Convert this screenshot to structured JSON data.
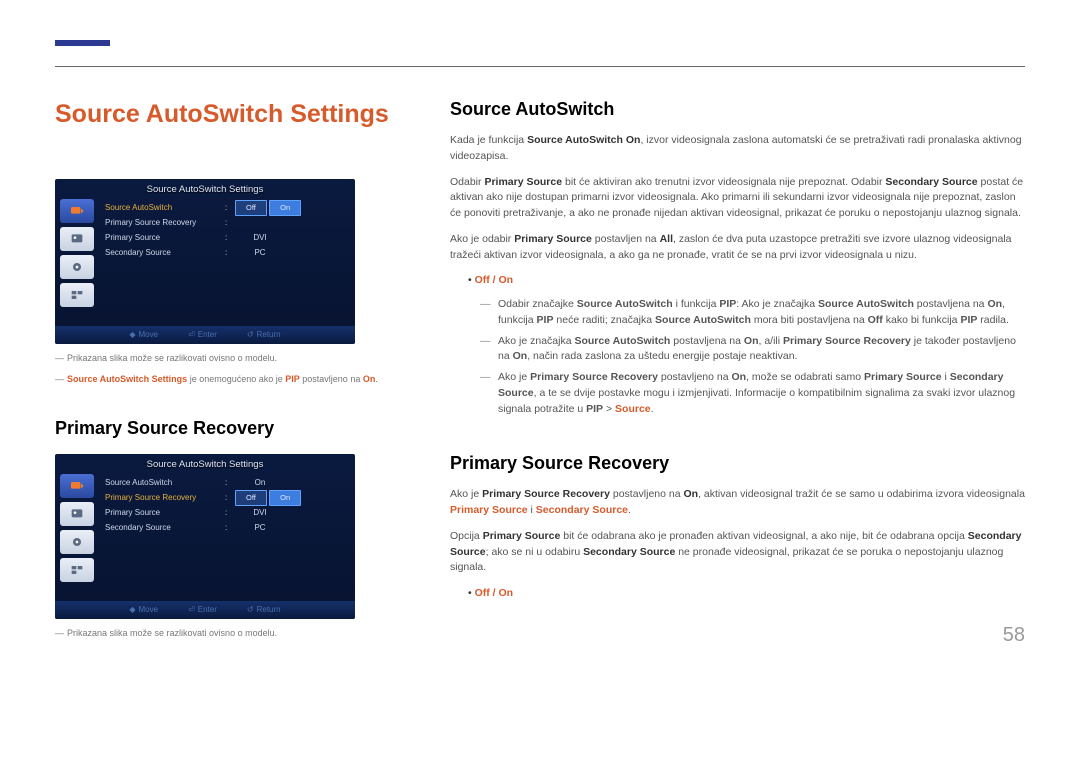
{
  "page_number": "58",
  "main_title": "Source AutoSwitch Settings",
  "left": {
    "osd1": {
      "title": "Source AutoSwitch Settings",
      "rows": [
        {
          "label": "Source AutoSwitch",
          "highlight": true,
          "pills": [
            "Off",
            "On"
          ],
          "active_pill": 1
        },
        {
          "label": "Primary Source Recovery",
          "value": ""
        },
        {
          "label": "Primary Source",
          "value": "DVI"
        },
        {
          "label": "Secondary Source",
          "value": "PC"
        }
      ],
      "footer": {
        "move": "Move",
        "enter": "Enter",
        "return": "Return"
      }
    },
    "note1_text": "Prikazana slika može se razlikovati ovisno o modelu.",
    "note2_pre": "Source AutoSwitch Settings",
    "note2_mid": " je onemogućeno ako je ",
    "note2_pip": "PIP",
    "note2_mid2": " postavljeno na ",
    "note2_on": "On",
    "note2_end": ".",
    "psr_title": "Primary Source Recovery",
    "osd2": {
      "title": "Source AutoSwitch Settings",
      "rows": [
        {
          "label": "Source AutoSwitch",
          "value": "On"
        },
        {
          "label": "Primary Source Recovery",
          "highlight": true,
          "pills": [
            "Off",
            "On"
          ],
          "active_pill": 1
        },
        {
          "label": "Primary Source",
          "value": "DVI"
        },
        {
          "label": "Secondary Source",
          "value": "PC"
        }
      ],
      "footer": {
        "move": "Move",
        "enter": "Enter",
        "return": "Return"
      }
    },
    "note3_text": "Prikazana slika može se razlikovati ovisno o modelu."
  },
  "right": {
    "sec1": {
      "title": "Source AutoSwitch",
      "p1_a": "Kada je funkcija ",
      "p1_b": "Source AutoSwitch On",
      "p1_c": ", izvor videosignala zaslona automatski će se pretraživati radi pronalaska aktivnog videozapisa.",
      "p2_a": "Odabir ",
      "p2_b": "Primary Source",
      "p2_c": " bit će aktiviran ako trenutni izvor videosignala nije prepoznat. Odabir ",
      "p2_d": "Secondary Source",
      "p2_e": " postat će aktivan ako nije dostupan primarni izvor videosignala. Ako primarni ili sekundarni izvor videosignala nije prepoznat, zaslon će ponoviti pretraživanje, a ako ne pronađe nijedan aktivan videosignal, prikazat će poruku o nepostojanju ulaznog signala.",
      "p3_a": "Ako je odabir ",
      "p3_b": "Primary Source",
      "p3_c": " postavljen na ",
      "p3_d": "All",
      "p3_e": ", zaslon će dva puta uzastopce pretražiti sve izvore ulaznog videosignala tražeći aktivan izvor videosignala, a ako ga ne pronađe, vratit će se na prvi izvor videosignala u nizu.",
      "bullet": "Off / On",
      "d1_a": "Odabir značajke ",
      "d1_b": "Source AutoSwitch",
      "d1_c": " i funkcija ",
      "d1_d": "PIP",
      "d1_e": ": Ako je značajka ",
      "d1_f": "Source AutoSwitch",
      "d1_g": " postavljena na ",
      "d1_h": "On",
      "d1_i": ", funkcija ",
      "d1_j": "PIP",
      "d1_k": " neće raditi; značajka ",
      "d1_l": "Source AutoSwitch",
      "d1_m": " mora biti postavljena na ",
      "d1_n": "Off",
      "d1_o": " kako bi funkcija ",
      "d1_p": "PIP",
      "d1_q": " radila.",
      "d2_a": "Ako je značajka ",
      "d2_b": "Source AutoSwitch",
      "d2_c": " postavljena na ",
      "d2_d": "On",
      "d2_e": ", a/ili ",
      "d2_f": "Primary Source Recovery",
      "d2_g": " je također postavljeno na ",
      "d2_h": "On",
      "d2_i": ", način rada zaslona za uštedu energije postaje neaktivan.",
      "d3_a": "Ako je ",
      "d3_b": "Primary Source Recovery",
      "d3_c": " postavljeno na ",
      "d3_d": "On",
      "d3_e": ", može se odabrati samo ",
      "d3_f": "Primary Source",
      "d3_g": " i ",
      "d3_h": "Secondary Source",
      "d3_i": ", a te se dvije postavke mogu i izmjenjivati. Informacije o kompatibilnim signalima za svaki izvor ulaznog signala potražite u ",
      "d3_j": "PIP",
      "d3_k": " > ",
      "d3_l": "Source",
      "d3_m": "."
    },
    "sec2": {
      "title": "Primary Source Recovery",
      "p1_a": "Ako je ",
      "p1_b": "Primary Source Recovery",
      "p1_c": " postavljeno na ",
      "p1_d": "On",
      "p1_e": ", aktivan videosignal tražit će se samo u odabirima izvora videosignala ",
      "p1_f": "Primary Source",
      "p1_g": " i ",
      "p1_h": "Secondary Source",
      "p1_i": ".",
      "p2_a": "Opcija ",
      "p2_b": "Primary Source",
      "p2_c": " bit će odabrana ako je pronađen aktivan videosignal, a ako nije, bit će odabrana opcija ",
      "p2_d": "Secondary Source",
      "p2_e": "; ako se ni u odabiru ",
      "p2_f": "Secondary Source",
      "p2_g": " ne pronađe videosignal, prikazat će se poruka o nepostojanju ulaznog signala.",
      "bullet": "Off / On"
    }
  }
}
